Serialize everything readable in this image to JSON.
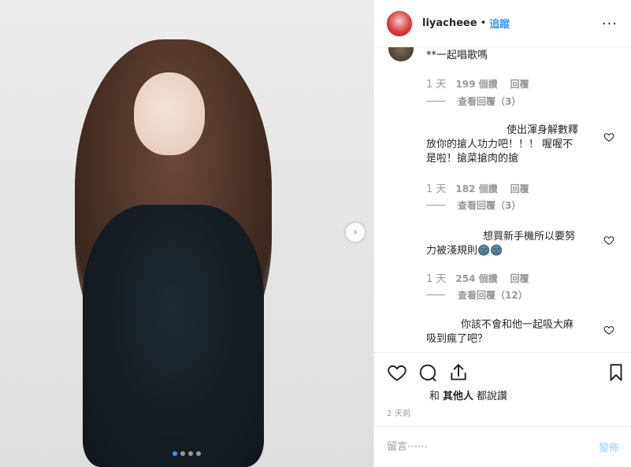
{
  "header": {
    "username": "liyacheee",
    "separator": "•",
    "follow_label": "追蹤",
    "more_label": "···"
  },
  "comments": [
    {
      "text": "**一起唱歌嗎",
      "time": "1 天",
      "likes": "199 個讚",
      "reply_label": "回覆",
      "view_replies": "查看回覆（3）"
    },
    {
      "text_lines": [
        "使出渾身解數釋",
        "放你的搶人功力吧！！！ 喔喔不",
        "是啦！搶菜搶肉的搶"
      ],
      "time": "1 天",
      "likes": "182 個讚",
      "reply_label": "回覆",
      "view_replies": "查看回覆（3）"
    },
    {
      "text_lines": [
        "想買新手機所以要努",
        "力被淺規則🌚🌚"
      ],
      "time": "1 天",
      "likes": "254 個讚",
      "reply_label": "回覆",
      "view_replies": "查看回覆（12）"
    },
    {
      "text_lines": [
        "你該不會和他一起吸大麻",
        "吸到瘋了吧？"
      ]
    }
  ],
  "likes_summary": {
    "and": "和",
    "others": "其他人",
    "liked": "都說讚"
  },
  "time_ago": "2 天前",
  "composer": {
    "placeholder": "留言⋯⋯",
    "publish_label": "發佈"
  },
  "carousel": {
    "dot_count": 4,
    "active_index": 0
  },
  "icons": {
    "like": "heart-outline-icon",
    "comment": "comment-bubble-icon",
    "share": "share-upload-icon",
    "save": "bookmark-icon",
    "next": "chevron-right-icon"
  },
  "colors": {
    "accent": "#3897f0",
    "muted": "#999999",
    "publish_disabled": "#b2dffc"
  }
}
